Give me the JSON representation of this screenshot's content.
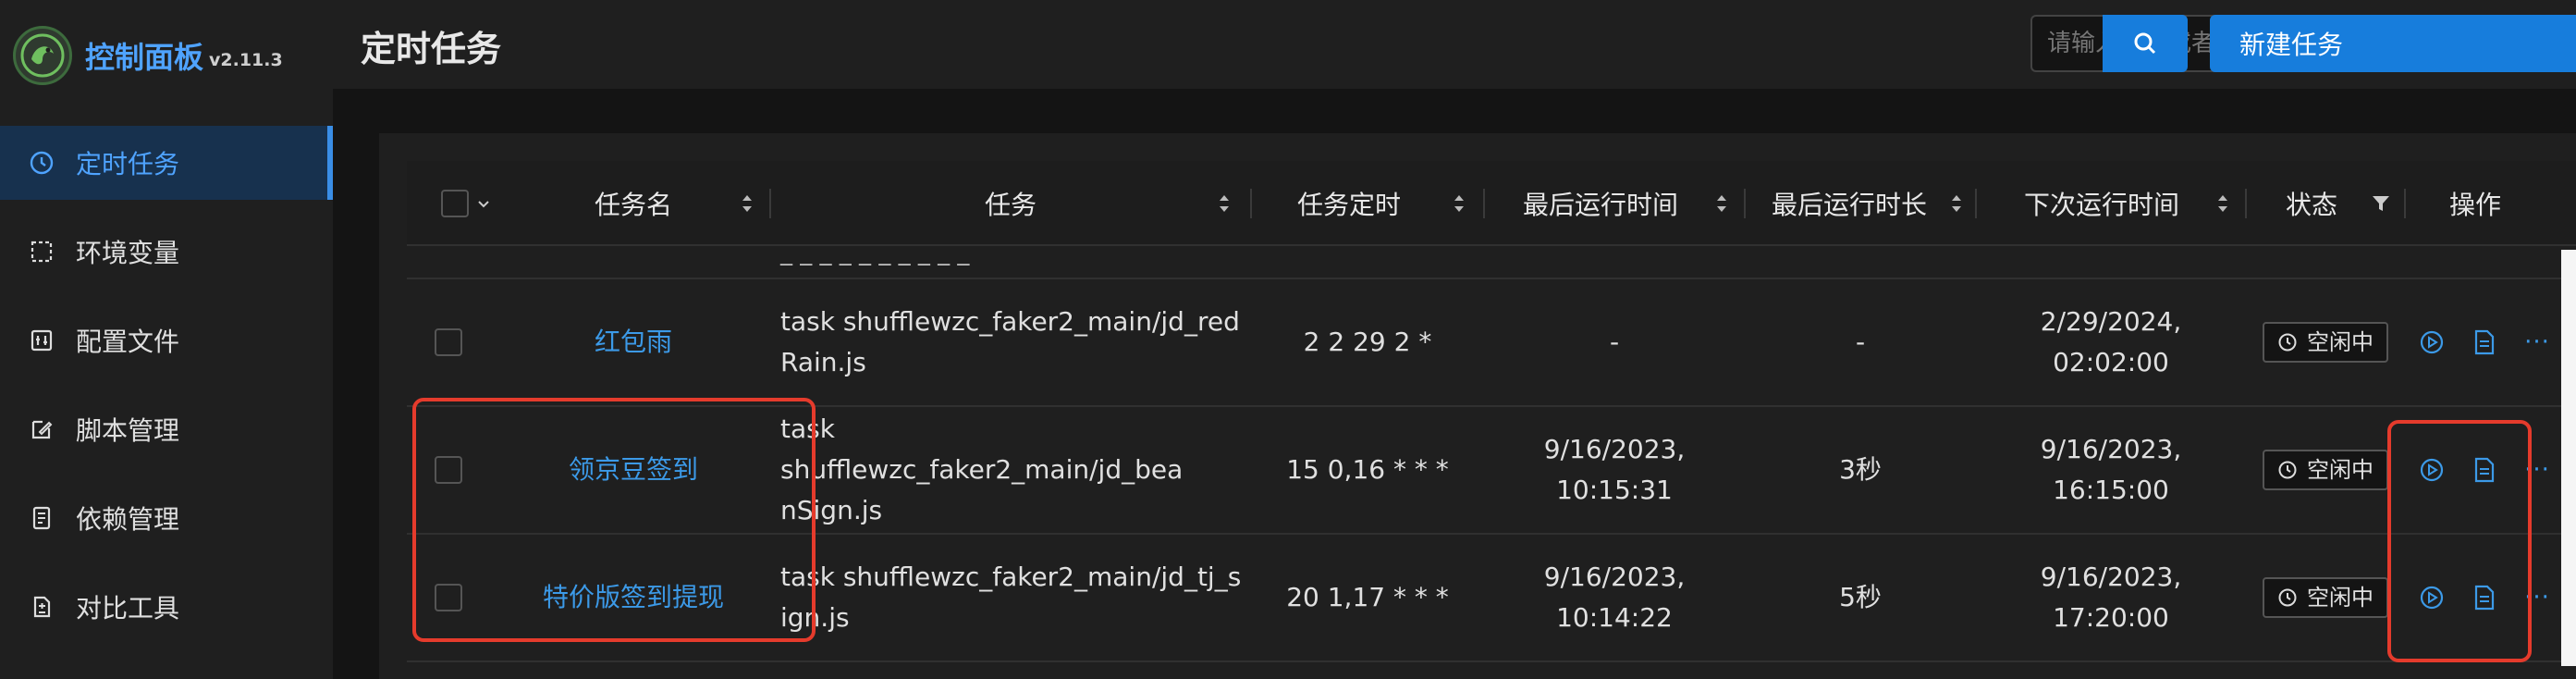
{
  "app": {
    "name": "控制面板",
    "version": "v2.11.3"
  },
  "sidebar": {
    "items": [
      {
        "label": "定时任务",
        "icon": "clock-icon",
        "active": true
      },
      {
        "label": "环境变量",
        "icon": "variable-icon"
      },
      {
        "label": "配置文件",
        "icon": "config-icon"
      },
      {
        "label": "脚本管理",
        "icon": "edit-icon"
      },
      {
        "label": "依赖管理",
        "icon": "dependency-icon"
      },
      {
        "label": "对比工具",
        "icon": "diff-icon"
      }
    ]
  },
  "header": {
    "title": "定时任务",
    "search_placeholder": "请输入名称或者关键词",
    "new_label": "新建任务"
  },
  "table": {
    "columns": [
      "任务名",
      "任务",
      "任务定时",
      "最后运行时间",
      "最后运行时长",
      "下次运行时间",
      "状态",
      "操作"
    ],
    "partial_row_fragment": "_ _ _ _ _ _ _ _ _ _",
    "rows": [
      {
        "name": "红包雨",
        "task_line1": "task shufflewzc_faker2_main/jd_red",
        "task_line2": "Rain.js",
        "schedule": "2 2 29 2 *",
        "last_run_line1": "-",
        "last_run_line2": "",
        "duration": "-",
        "next_run_line1": "2/29/2024,",
        "next_run_line2": "02:02:00",
        "status": "空闲中"
      },
      {
        "name": "领京豆签到",
        "task_line1": "task shufflewzc_faker2_main/jd_bea",
        "task_line2": "nSign.js",
        "schedule": "15 0,16 * * *",
        "last_run_line1": "9/16/2023,",
        "last_run_line2": "10:15:31",
        "duration": "3秒",
        "next_run_line1": "9/16/2023,",
        "next_run_line2": "16:15:00",
        "status": "空闲中"
      },
      {
        "name": "特价版签到提现",
        "task_line1": "task shufflewzc_faker2_main/jd_tj_s",
        "task_line2": "ign.js",
        "schedule": "20 1,17 * * *",
        "last_run_line1": "9/16/2023,",
        "last_run_line2": "10:14:22",
        "duration": "5秒",
        "next_run_line1": "9/16/2023,",
        "next_run_line2": "17:20:00",
        "status": "空闲中"
      }
    ],
    "more_label": "···"
  },
  "colors": {
    "accent": "#177ddc",
    "link": "#3c9ae8",
    "highlight": "#e53b2c"
  }
}
